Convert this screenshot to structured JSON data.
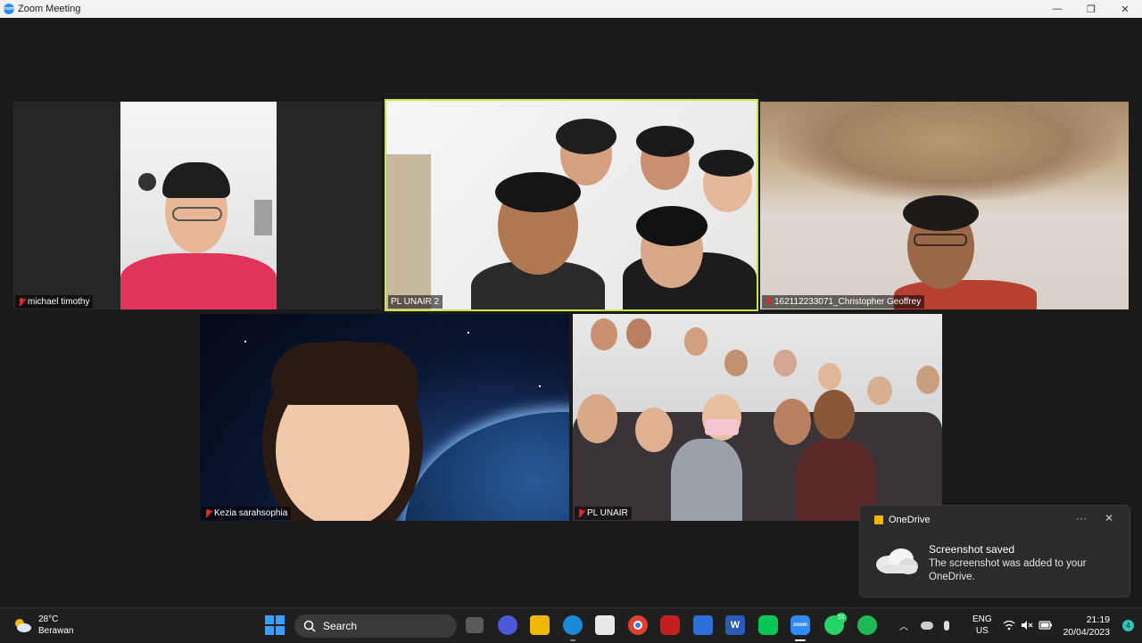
{
  "window": {
    "title": "Zoom Meeting",
    "minimize": "—",
    "maximize": "❐",
    "close": "✕"
  },
  "participants": [
    {
      "name": "michael timothy",
      "muted": true
    },
    {
      "name": "PL UNAIR 2",
      "muted": false,
      "active_speaker": true
    },
    {
      "name": "162112233071_Christopher Geoffrey",
      "muted": true
    },
    {
      "name": "Kezia sarahsophia",
      "muted": true
    },
    {
      "name": "PL UNAIR",
      "muted": true
    }
  ],
  "toast": {
    "app": "OneDrive",
    "more": "···",
    "close": "✕",
    "title": "Screenshot saved",
    "body": "The screenshot was added to your OneDrive."
  },
  "taskbar": {
    "weather_temp": "28°C",
    "weather_desc": "Berawan",
    "search_placeholder": "Search",
    "whatsapp_badge": "51",
    "language": "ENG",
    "region": "US",
    "time": "21:19",
    "date": "20/04/2023",
    "notification_count": "4"
  },
  "colors": {
    "active_speaker_border": "#c8e64a",
    "zoom_blue": "#2d8cff",
    "muted_red": "#e02828"
  }
}
